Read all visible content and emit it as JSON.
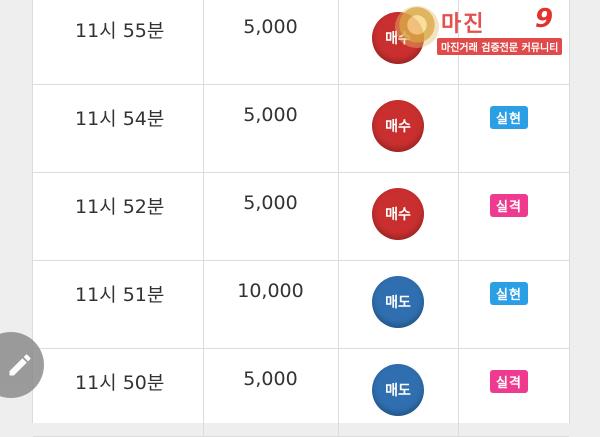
{
  "trades": [
    {
      "time": "11시 55분",
      "amount": "5,000",
      "side": "매수",
      "side_type": "buy",
      "result": "",
      "result_type": ""
    },
    {
      "time": "11시 54분",
      "amount": "5,000",
      "side": "매수",
      "side_type": "buy",
      "result": "실현",
      "result_type": "win"
    },
    {
      "time": "11시 52분",
      "amount": "5,000",
      "side": "매수",
      "side_type": "buy",
      "result": "실격",
      "result_type": "loss"
    },
    {
      "time": "11시 51분",
      "amount": "10,000",
      "side": "매도",
      "side_type": "sell",
      "result": "실현",
      "result_type": "win"
    },
    {
      "time": "11시 50분",
      "amount": "5,000",
      "side": "매도",
      "side_type": "sell",
      "result": "실격",
      "result_type": "loss"
    }
  ],
  "colors": {
    "buy": "#c92f2f",
    "sell": "#2f6fb0",
    "win": "#2b9fe6",
    "loss": "#ee3b8f"
  },
  "fab": {
    "icon": "pencil-icon"
  },
  "watermark": {
    "title": "마진",
    "mark": "9",
    "subtitle": "마진거래 검증전문 커뮤니티"
  }
}
